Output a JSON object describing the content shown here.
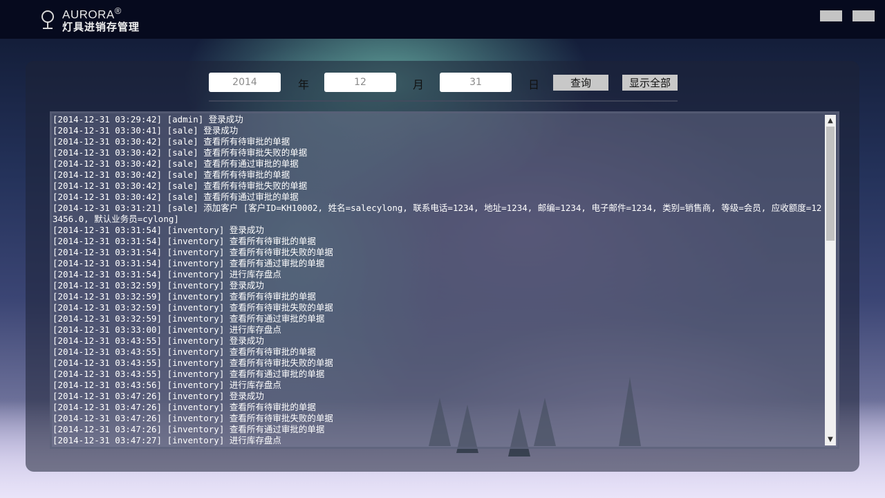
{
  "header": {
    "brand": "AURORA",
    "brand_mark": "®",
    "subtitle": "灯具进销存管理",
    "window_buttons": [
      "minimize-button",
      "close-button"
    ]
  },
  "query": {
    "year_value": "2014",
    "year_unit": "年",
    "month_value": "12",
    "month_unit": "月",
    "day_value": "31",
    "day_unit": "日",
    "query_button": "查询",
    "show_all_button": "显示全部"
  },
  "log": {
    "lines": [
      "[2014-12-31 03:29:42] [admin] 登录成功",
      "[2014-12-31 03:30:41] [sale] 登录成功",
      "[2014-12-31 03:30:42] [sale] 查看所有待审批的单据",
      "[2014-12-31 03:30:42] [sale] 查看所有待审批失败的单据",
      "[2014-12-31 03:30:42] [sale] 查看所有通过审批的单据",
      "[2014-12-31 03:30:42] [sale] 查看所有待审批的单据",
      "[2014-12-31 03:30:42] [sale] 查看所有待审批失败的单据",
      "[2014-12-31 03:30:42] [sale] 查看所有通过审批的单据",
      "[2014-12-31 03:31:21] [sale] 添加客户 [客户ID=KH10002, 姓名=salecylong, 联系电话=1234, 地址=1234, 邮编=1234, 电子邮件=1234, 类别=销售商, 等级=会员, 应收额度=123456.0, 默认业务员=cylong]",
      "[2014-12-31 03:31:54] [inventory] 登录成功",
      "[2014-12-31 03:31:54] [inventory] 查看所有待审批的单据",
      "[2014-12-31 03:31:54] [inventory] 查看所有待审批失败的单据",
      "[2014-12-31 03:31:54] [inventory] 查看所有通过审批的单据",
      "[2014-12-31 03:31:54] [inventory] 进行库存盘点",
      "[2014-12-31 03:32:59] [inventory] 登录成功",
      "[2014-12-31 03:32:59] [inventory] 查看所有待审批的单据",
      "[2014-12-31 03:32:59] [inventory] 查看所有待审批失败的单据",
      "[2014-12-31 03:32:59] [inventory] 查看所有通过审批的单据",
      "[2014-12-31 03:33:00] [inventory] 进行库存盘点",
      "[2014-12-31 03:43:55] [inventory] 登录成功",
      "[2014-12-31 03:43:55] [inventory] 查看所有待审批的单据",
      "[2014-12-31 03:43:55] [inventory] 查看所有待审批失败的单据",
      "[2014-12-31 03:43:55] [inventory] 查看所有通过审批的单据",
      "[2014-12-31 03:43:56] [inventory] 进行库存盘点",
      "[2014-12-31 03:47:26] [inventory] 登录成功",
      "[2014-12-31 03:47:26] [inventory] 查看所有待审批的单据",
      "[2014-12-31 03:47:26] [inventory] 查看所有待审批失败的单据",
      "[2014-12-31 03:47:26] [inventory] 查看所有通过审批的单据",
      "[2014-12-31 03:47:27] [inventory] 进行库存盘点"
    ],
    "scroll_up_icon": "▲",
    "scroll_down_icon": "▼"
  }
}
